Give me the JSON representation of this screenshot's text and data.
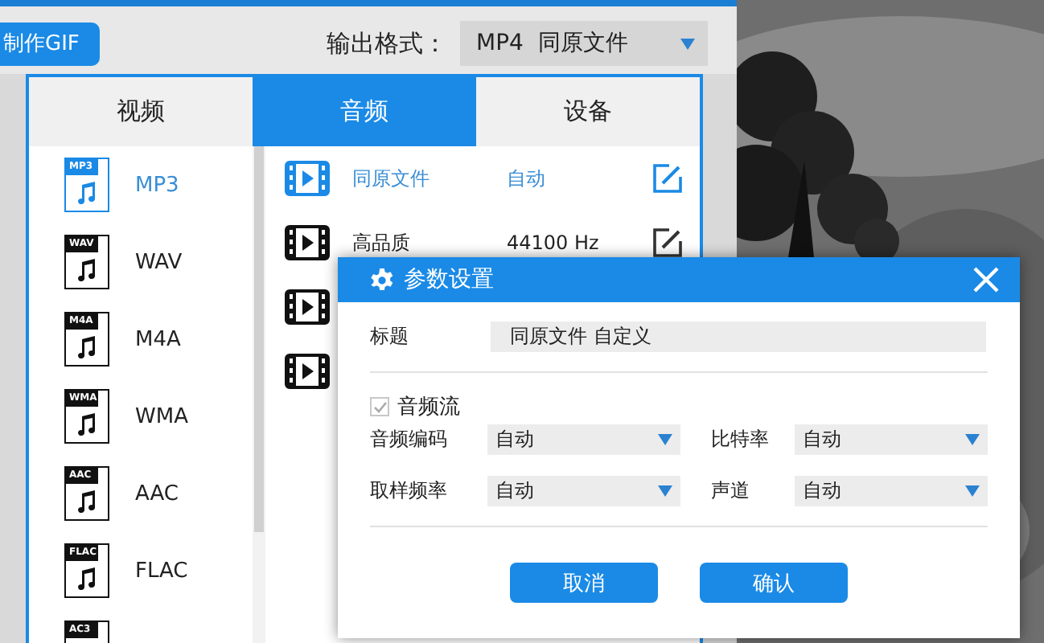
{
  "toolbar": {
    "gif_button": "制作GIF",
    "output_label": "输出格式：",
    "output_value": "MP4  同原文件"
  },
  "format_popup": {
    "tabs": [
      {
        "label": "视频",
        "selected": false
      },
      {
        "label": "音频",
        "selected": true
      },
      {
        "label": "设备",
        "selected": false
      }
    ],
    "formats": [
      {
        "badge": "MP3",
        "label": "MP3",
        "selected": true
      },
      {
        "badge": "WAV",
        "label": "WAV",
        "selected": false
      },
      {
        "badge": "M4A",
        "label": "M4A",
        "selected": false
      },
      {
        "badge": "WMA",
        "label": "WMA",
        "selected": false
      },
      {
        "badge": "AAC",
        "label": "AAC",
        "selected": false
      },
      {
        "badge": "FLAC",
        "label": "FLAC",
        "selected": false
      },
      {
        "badge": "AC3",
        "selected": false
      }
    ],
    "presets": [
      {
        "name": "同原文件",
        "value": "自动",
        "selected": true
      },
      {
        "name": "高品质",
        "value": "44100 Hz",
        "selected": false
      },
      {
        "selected": false
      },
      {
        "selected": false
      }
    ]
  },
  "dialog": {
    "title": "参数设置",
    "title_label": "标题",
    "title_value": "同原文件 自定义",
    "audio_stream": {
      "label": "音频流",
      "checked": true,
      "disabled": true
    },
    "fields": [
      {
        "label": "音频编码",
        "value": "自动"
      },
      {
        "label": "比特率",
        "value": "自动"
      },
      {
        "label": "取样频率",
        "value": "自动"
      },
      {
        "label": "声道",
        "value": "自动"
      }
    ],
    "buttons": [
      "取消",
      "确认"
    ]
  }
}
